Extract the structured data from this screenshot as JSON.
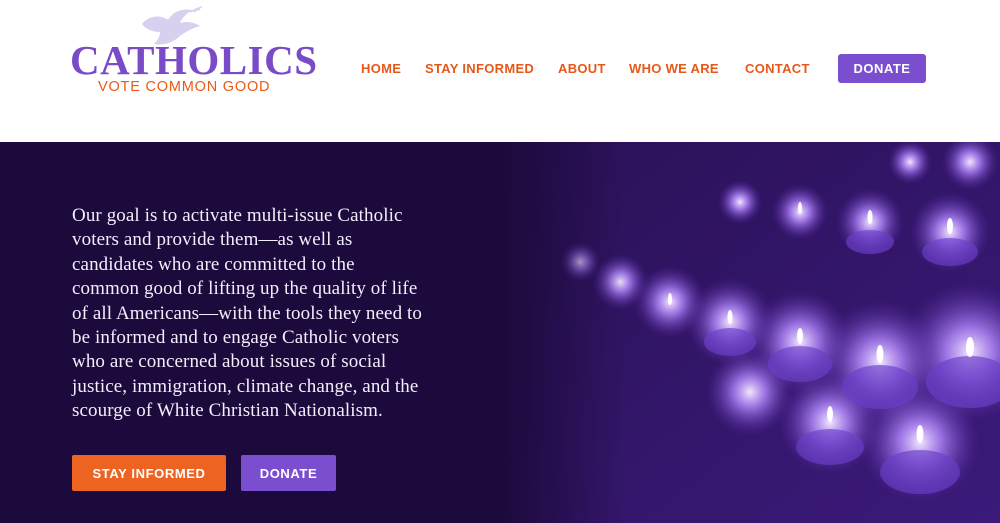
{
  "logo": {
    "title": "CATHOLICS",
    "subtitle": "VOTE COMMON GOOD",
    "icon": "dove-icon"
  },
  "nav": {
    "items": [
      "HOME",
      "STAY INFORMED",
      "ABOUT",
      "WHO WE ARE",
      "CONTACT"
    ],
    "donate_label": "DONATE"
  },
  "hero": {
    "text": "Our goal is to activate multi-issue Catholic voters and provide them—as well as candidates who are committed to the common good of lifting up the quality of life of all Americans—with the tools they need to be informed and to engage Catholic voters who are concerned about issues of social justice, immigration, climate change, and the scourge of White Christian Nationalism.",
    "lines": [
      "Our goal is to activate multi-issue Catholic",
      "voters and provide them—as well as",
      "candidates who are committed to the",
      "common good of lifting up the quality of life",
      "of all Americans—with the tools they need to",
      "be informed and to engage Catholic voters",
      "who are concerned about issues of social",
      "justice, immigration, climate change, and the",
      "scourge of White Christian Nationalism."
    ],
    "primary_button": "STAY INFORMED",
    "secondary_button": "DONATE",
    "image": "purple-votive-candles"
  },
  "colors": {
    "brand_purple": "#7b4ed0",
    "brand_orange": "#e6581a",
    "hero_bg": "#1c0a3c",
    "hero_text": "#f3eefc"
  }
}
